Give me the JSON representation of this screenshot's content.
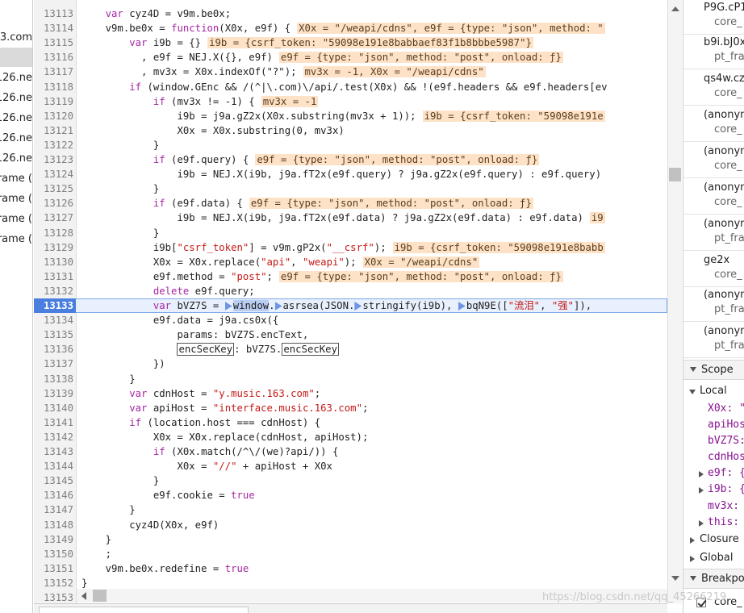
{
  "left_files": [
    "3.com",
    "",
    "126.ne",
    "126.ne",
    "126.ne",
    "126.ne",
    "126.ne",
    "rame (",
    "rame (",
    "rame (",
    "rame ("
  ],
  "editor": {
    "current_line": "13133",
    "lines": [
      {
        "n": "13113",
        "c": [
          [
            "",
            "    "
          ],
          [
            "kw",
            "var"
          ],
          [
            "",
            " cyz4D = v9m.be0x;"
          ]
        ]
      },
      {
        "n": "13114",
        "c": [
          [
            "",
            "    v9m.be0x = "
          ],
          [
            "kw",
            "function"
          ],
          [
            "",
            "(X0x, e9f) {"
          ],
          [
            "inl",
            "X0x = \"/weapi/cdns\", e9f = {type: \"json\", method: \""
          ]
        ]
      },
      {
        "n": "13115",
        "c": [
          [
            "",
            "        "
          ],
          [
            "kw",
            "var"
          ],
          [
            "",
            " i9b = {}"
          ],
          [
            "inl",
            "i9b = {csrf_token: \"59098e191e8babbaef83f1b8bbbe5987\"}"
          ]
        ]
      },
      {
        "n": "13116",
        "c": [
          [
            "",
            "          , e9f = NEJ.X({}, e9f)"
          ],
          [
            "inl",
            "e9f = {type: \"json\", method: \"post\", onload: ƒ}"
          ]
        ]
      },
      {
        "n": "13117",
        "c": [
          [
            "",
            "          , mv3x = X0x.indexOf(\"?\");"
          ],
          [
            "inl",
            "mv3x = -1, X0x = \"/weapi/cdns\""
          ]
        ]
      },
      {
        "n": "13118",
        "c": [
          [
            "",
            "        "
          ],
          [
            "kw",
            "if"
          ],
          [
            "",
            " (window.GEnc && /(^|\\.com)\\/api/.test(X0x) && !(e9f.headers && e9f.headers[ev"
          ]
        ]
      },
      {
        "n": "13119",
        "c": [
          [
            "",
            "            "
          ],
          [
            "kw",
            "if"
          ],
          [
            "",
            " (mv3x != -1) {"
          ],
          [
            "inl",
            "mv3x = -1"
          ]
        ]
      },
      {
        "n": "13120",
        "c": [
          [
            "",
            "                i9b = j9a.gZ2x(X0x.substring(mv3x + 1));"
          ],
          [
            "inl",
            "i9b = {csrf_token: \"59098e191e"
          ]
        ]
      },
      {
        "n": "13121",
        "c": [
          [
            "",
            "                X0x = X0x.substring(0, mv3x)"
          ]
        ]
      },
      {
        "n": "13122",
        "c": [
          [
            "",
            "            }"
          ]
        ]
      },
      {
        "n": "13123",
        "c": [
          [
            "",
            "            "
          ],
          [
            "kw",
            "if"
          ],
          [
            "",
            " (e9f.query) {"
          ],
          [
            "inl",
            "e9f = {type: \"json\", method: \"post\", onload: ƒ}"
          ]
        ]
      },
      {
        "n": "13124",
        "c": [
          [
            "",
            "                i9b = NEJ.X(i9b, j9a.fT2x(e9f.query) ? j9a.gZ2x(e9f.query) : e9f.query)"
          ]
        ]
      },
      {
        "n": "13125",
        "c": [
          [
            "",
            "            }"
          ]
        ]
      },
      {
        "n": "13126",
        "c": [
          [
            "",
            "            "
          ],
          [
            "kw",
            "if"
          ],
          [
            "",
            " (e9f.data) {"
          ],
          [
            "inl",
            "e9f = {type: \"json\", method: \"post\", onload: ƒ}"
          ]
        ]
      },
      {
        "n": "13127",
        "c": [
          [
            "",
            "                i9b = NEJ.X(i9b, j9a.fT2x(e9f.data) ? j9a.gZ2x(e9f.data) : e9f.data)"
          ],
          [
            "inl",
            "i9"
          ]
        ]
      },
      {
        "n": "13128",
        "c": [
          [
            "",
            "            }"
          ]
        ]
      },
      {
        "n": "13129",
        "c": [
          [
            "",
            "            i9b["
          ],
          [
            "str",
            "\"csrf_token\""
          ],
          [
            "",
            "] = v9m.gP2x("
          ],
          [
            "str",
            "\"__csrf\""
          ],
          [
            "",
            ");"
          ],
          [
            "inl",
            "i9b = {csrf_token: \"59098e191e8babb"
          ]
        ]
      },
      {
        "n": "13130",
        "c": [
          [
            "",
            "            X0x = X0x.replace("
          ],
          [
            "str",
            "\"api\""
          ],
          [
            "",
            ", "
          ],
          [
            "str",
            "\"weapi\""
          ],
          [
            "",
            ");"
          ],
          [
            "inl",
            "X0x = \"/weapi/cdns\""
          ]
        ]
      },
      {
        "n": "13131",
        "c": [
          [
            "",
            "            e9f.method = "
          ],
          [
            "str",
            "\"post\""
          ],
          [
            "",
            ";"
          ],
          [
            "inl",
            "e9f = {type: \"json\", method: \"post\", onload: ƒ}"
          ]
        ]
      },
      {
        "n": "13132",
        "c": [
          [
            "",
            "            "
          ],
          [
            "kw",
            "delete"
          ],
          [
            "",
            " e9f.query;"
          ]
        ]
      },
      {
        "n": "13133",
        "c": [
          [
            "",
            "            "
          ],
          [
            "kw",
            "var"
          ],
          [
            "",
            " bVZ7S = "
          ],
          [
            "arr",
            ""
          ],
          [
            "hl",
            "window"
          ],
          [
            "",
            "."
          ],
          [
            "arr",
            ""
          ],
          [
            "",
            "asrsea(JSON."
          ],
          [
            "arr",
            ""
          ],
          [
            "",
            "stringify(i9b), "
          ],
          [
            "arr",
            ""
          ],
          [
            "",
            "bqN9E(["
          ],
          [
            "str",
            "\"流泪\""
          ],
          [
            "",
            ", "
          ],
          [
            "str",
            "\"强\""
          ],
          [
            "",
            "]),"
          ]
        ]
      },
      {
        "n": "13134",
        "c": [
          [
            "",
            "            e9f.data = j9a.cs0x({"
          ]
        ]
      },
      {
        "n": "13135",
        "c": [
          [
            "",
            "                params: bVZ7S.encText,"
          ]
        ]
      },
      {
        "n": "13136",
        "c": [
          [
            "",
            "                "
          ],
          [
            "box",
            "encSecKey"
          ],
          [
            "",
            ": bVZ7S."
          ],
          [
            "box",
            "encSecKey"
          ]
        ]
      },
      {
        "n": "13137",
        "c": [
          [
            "",
            "            })"
          ]
        ]
      },
      {
        "n": "13138",
        "c": [
          [
            "",
            "        }"
          ]
        ]
      },
      {
        "n": "13139",
        "c": [
          [
            "",
            "        "
          ],
          [
            "kw",
            "var"
          ],
          [
            "",
            " cdnHost = "
          ],
          [
            "str",
            "\"y.music.163.com\""
          ],
          [
            "",
            ";"
          ]
        ]
      },
      {
        "n": "13140",
        "c": [
          [
            "",
            "        "
          ],
          [
            "kw",
            "var"
          ],
          [
            "",
            " apiHost = "
          ],
          [
            "str",
            "\"interface.music.163.com\""
          ],
          [
            "",
            ";"
          ]
        ]
      },
      {
        "n": "13141",
        "c": [
          [
            "",
            "        "
          ],
          [
            "kw",
            "if"
          ],
          [
            "",
            " (location.host === cdnHost) {"
          ]
        ]
      },
      {
        "n": "13142",
        "c": [
          [
            "",
            "            X0x = X0x.replace(cdnHost, apiHost);"
          ]
        ]
      },
      {
        "n": "13143",
        "c": [
          [
            "",
            "            "
          ],
          [
            "kw",
            "if"
          ],
          [
            "",
            " (X0x.match(/^\\/(we)?api/)) {"
          ]
        ]
      },
      {
        "n": "13144",
        "c": [
          [
            "",
            "                X0x = "
          ],
          [
            "str",
            "\"//\""
          ],
          [
            "",
            " + apiHost + X0x"
          ]
        ]
      },
      {
        "n": "13145",
        "c": [
          [
            "",
            "            }"
          ]
        ]
      },
      {
        "n": "13146",
        "c": [
          [
            "",
            "            e9f.cookie = "
          ],
          [
            "kw",
            "true"
          ]
        ]
      },
      {
        "n": "13147",
        "c": [
          [
            "",
            "        }"
          ]
        ]
      },
      {
        "n": "13148",
        "c": [
          [
            "",
            "        cyz4D(X0x, e9f)"
          ]
        ]
      },
      {
        "n": "13149",
        "c": [
          [
            "",
            "    }"
          ]
        ]
      },
      {
        "n": "13150",
        "c": [
          [
            "",
            "    ;"
          ]
        ]
      },
      {
        "n": "13151",
        "c": [
          [
            "",
            "    v9m.be0x.redefine = "
          ],
          [
            "kw",
            "true"
          ]
        ]
      },
      {
        "n": "13152",
        "c": [
          [
            "",
            "}"
          ]
        ]
      },
      {
        "n": "13153",
        "c": [
          [
            "",
            ""
          ]
        ]
      }
    ]
  },
  "call_stack": [
    {
      "fn": "P9G.cP1",
      "file": "core_"
    },
    {
      "fn": "b9i.bJ0x",
      "file": "pt_fra"
    },
    {
      "fn": "qs4w.cz",
      "file": "core_"
    },
    {
      "fn": "(anonym",
      "file": "core_"
    },
    {
      "fn": "(anonym",
      "file": "core_"
    },
    {
      "fn": "(anonym",
      "file": "core_"
    },
    {
      "fn": "(anonym",
      "file": "pt_fra"
    },
    {
      "fn": "ge2x",
      "file": "core_"
    },
    {
      "fn": "(anonym",
      "file": "pt_fra"
    },
    {
      "fn": "(anonym",
      "file": "pt_fra"
    }
  ],
  "scope": {
    "title": "Scope",
    "local_label": "Local",
    "vars": [
      "X0x: \"",
      "apiHos",
      "bVZ7S:",
      "cdnHos"
    ],
    "expandable": [
      "e9f: {",
      "i9b: {"
    ],
    "mv3x": "mv3x:",
    "this": "this:",
    "closure": "Closure",
    "global": "Global"
  },
  "breakpoints": {
    "title": "Breakpo",
    "item": "core_"
  },
  "watermark": "https://blog.csdn.net/qq_45266219"
}
